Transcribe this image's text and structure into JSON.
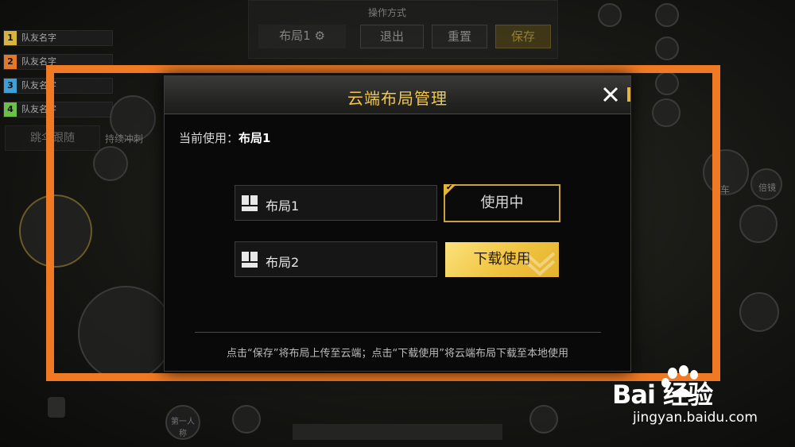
{
  "background_hud": {
    "teams": [
      {
        "num": "1",
        "label": "队友名字",
        "color": "#d7b43d"
      },
      {
        "num": "2",
        "label": "队友名字",
        "color": "#e07a2a"
      },
      {
        "num": "3",
        "label": "队友名字",
        "color": "#3fa0d8"
      },
      {
        "num": "4",
        "label": "队友名字",
        "color": "#6cc04a"
      }
    ],
    "top_bar": {
      "title": "操作方式",
      "layout_label": "布局1",
      "exit_label": "退出",
      "reset_label": "重置",
      "save_label": "保存"
    },
    "follow_label": "跳伞跟随",
    "sprint_label": "持续冲刺",
    "car_label": "车",
    "zoom_label": "倍镜",
    "perspective_label": "第一人称"
  },
  "dialog": {
    "title": "云端布局管理",
    "current_prefix": "当前使用：",
    "current_value": "布局1",
    "layouts": [
      {
        "name": "布局1",
        "action": "使用中",
        "state": "in-use"
      },
      {
        "name": "布局2",
        "action": "下载使用",
        "state": "download"
      }
    ],
    "footer": "点击“保存”将布局上传至云端；点击“下载使用”将云端布局下载至本地使用",
    "accent_color": "#f1c84d"
  },
  "highlight_color": "#f07a24",
  "watermark": {
    "brand": "Bai  经验",
    "url": "jingyan.baidu.com"
  }
}
